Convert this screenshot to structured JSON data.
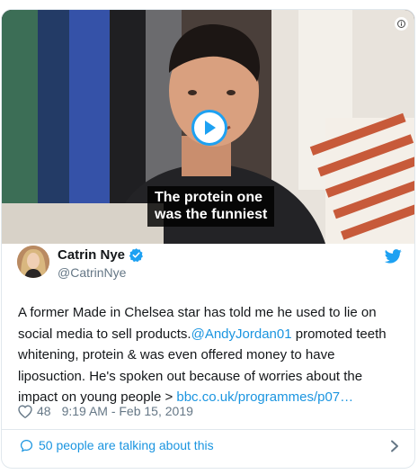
{
  "media": {
    "caption": "The protein one\nwas the funniest"
  },
  "author": {
    "display_name": "Catrin Nye",
    "handle": "@CatrinNye"
  },
  "tweet": {
    "text_1": "A former Made in Chelsea star has told me he used to lie on social media to sell products.",
    "mention": "@AndyJordan01",
    "text_2": " promoted teeth whitening, protein & was even offered money to have liposuction. He's spoken out because of worries about the impact on young people > ",
    "link": "bbc.co.uk/programmes/p07…"
  },
  "meta": {
    "likes": "48",
    "timestamp": "9:19 AM - Feb 15, 2019"
  },
  "conversation": {
    "label": "50 people are talking about this"
  },
  "colors": {
    "accent": "#1da1f2",
    "link": "#1b95e0",
    "muted": "#657786"
  },
  "icons": [
    "info-icon",
    "play-icon",
    "verified-badge-icon",
    "twitter-bird-icon",
    "heart-icon",
    "speech-bubble-icon",
    "chevron-right-icon"
  ]
}
